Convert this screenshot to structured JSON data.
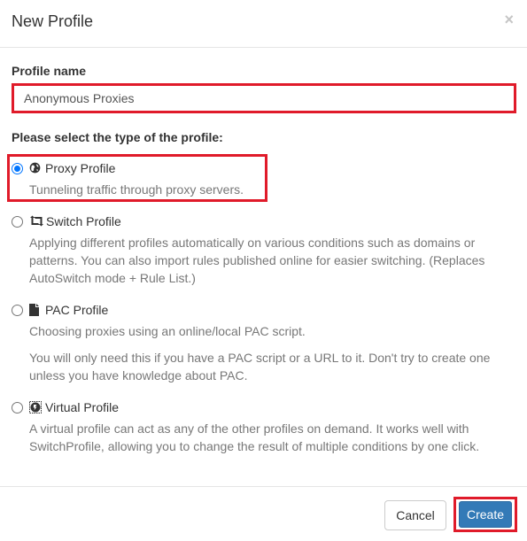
{
  "dialog": {
    "title": "New Profile",
    "close_label": "×"
  },
  "form": {
    "profile_name_label": "Profile name",
    "profile_name_value": "Anonymous Proxies",
    "type_label": "Please select the type of the profile:"
  },
  "options": [
    {
      "title": "Proxy Profile",
      "icon": "globe-icon",
      "selected": true,
      "descriptions": [
        "Tunneling traffic through proxy servers."
      ]
    },
    {
      "title": "Switch Profile",
      "icon": "retweet-icon",
      "selected": false,
      "descriptions": [
        "Applying different profiles automatically on various conditions such as domains or patterns. You can also import rules published online for easier switching. (Replaces AutoSwitch mode + Rule List.)"
      ]
    },
    {
      "title": "PAC Profile",
      "icon": "file-icon",
      "selected": false,
      "descriptions": [
        "Choosing proxies using an online/local PAC script.",
        "You will only need this if you have a PAC script or a URL to it. Don't try to create one unless you have knowledge about PAC."
      ]
    },
    {
      "title": "Virtual Profile",
      "icon": "virtual-icon",
      "selected": false,
      "descriptions": [
        "A virtual profile can act as any of the other profiles on demand. It works well with SwitchProfile, allowing you to change the result of multiple conditions by one click."
      ]
    }
  ],
  "footer": {
    "cancel_label": "Cancel",
    "create_label": "Create"
  },
  "colors": {
    "primary": "#337ab7",
    "highlight": "#e01b2a",
    "radio_checked": "#0075ff"
  }
}
